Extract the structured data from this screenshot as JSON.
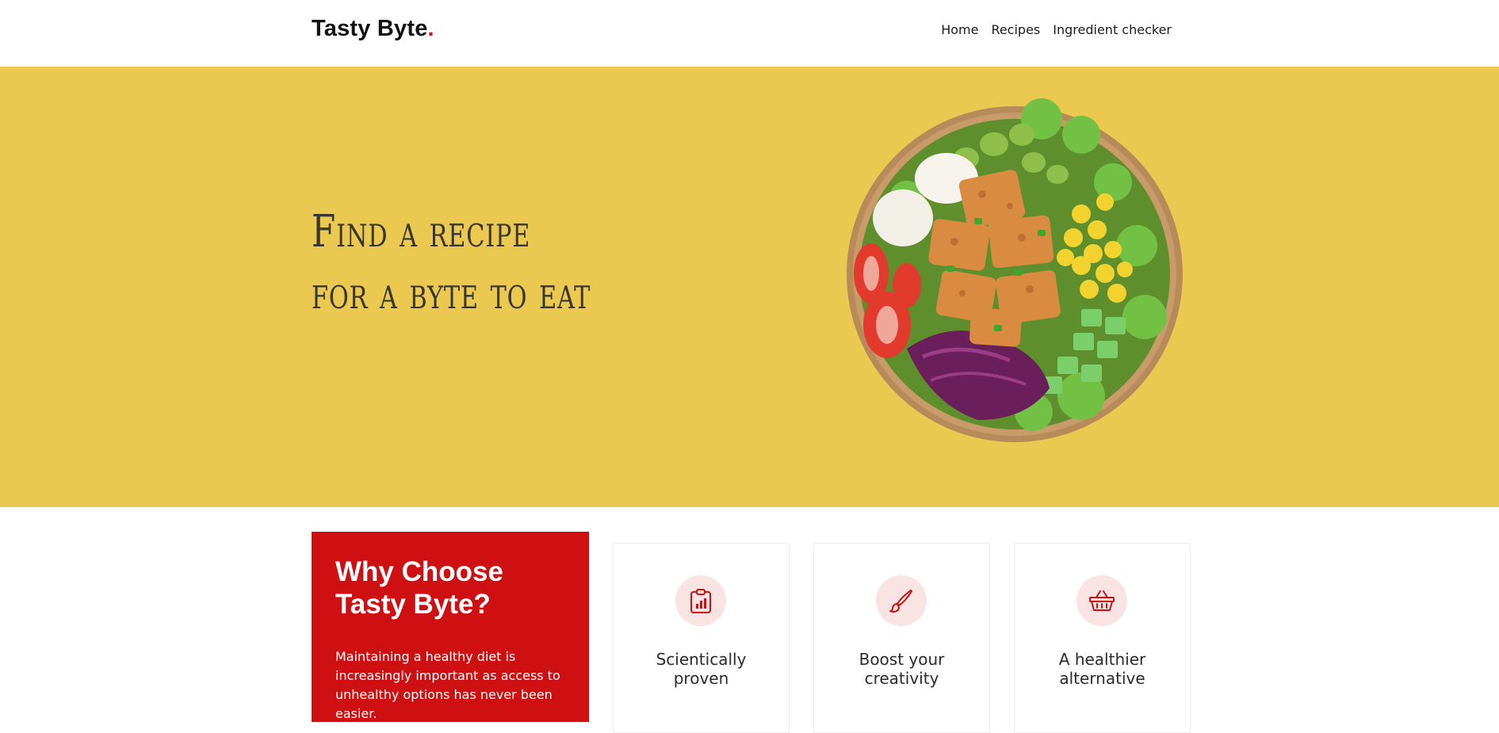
{
  "header": {
    "brand": "Tasty Byte",
    "brand_dot": ".",
    "nav": [
      "Home",
      "Recipes",
      "Ingredient checker"
    ]
  },
  "hero": {
    "title_line1": "Find a recipe",
    "title_line2": "for a byte to eat",
    "image": "salad-bowl-image"
  },
  "why": {
    "title_line1": "Why Choose",
    "title_line2": "Tasty Byte?",
    "text": "Maintaining a healthy diet is increasingly important as access to unhealthy options has never been easier."
  },
  "features": [
    {
      "icon": "clipboard-chart-icon",
      "line1": "Scientically",
      "line2": "proven"
    },
    {
      "icon": "paintbrush-icon",
      "line1": "Boost your",
      "line2": "creativity"
    },
    {
      "icon": "basket-icon",
      "line1": "A healthier",
      "line2": "alternative"
    }
  ],
  "colors": {
    "hero_bg": "#ebc950",
    "accent_red": "#cf1012",
    "icon_bg": "#f9e3e3"
  }
}
